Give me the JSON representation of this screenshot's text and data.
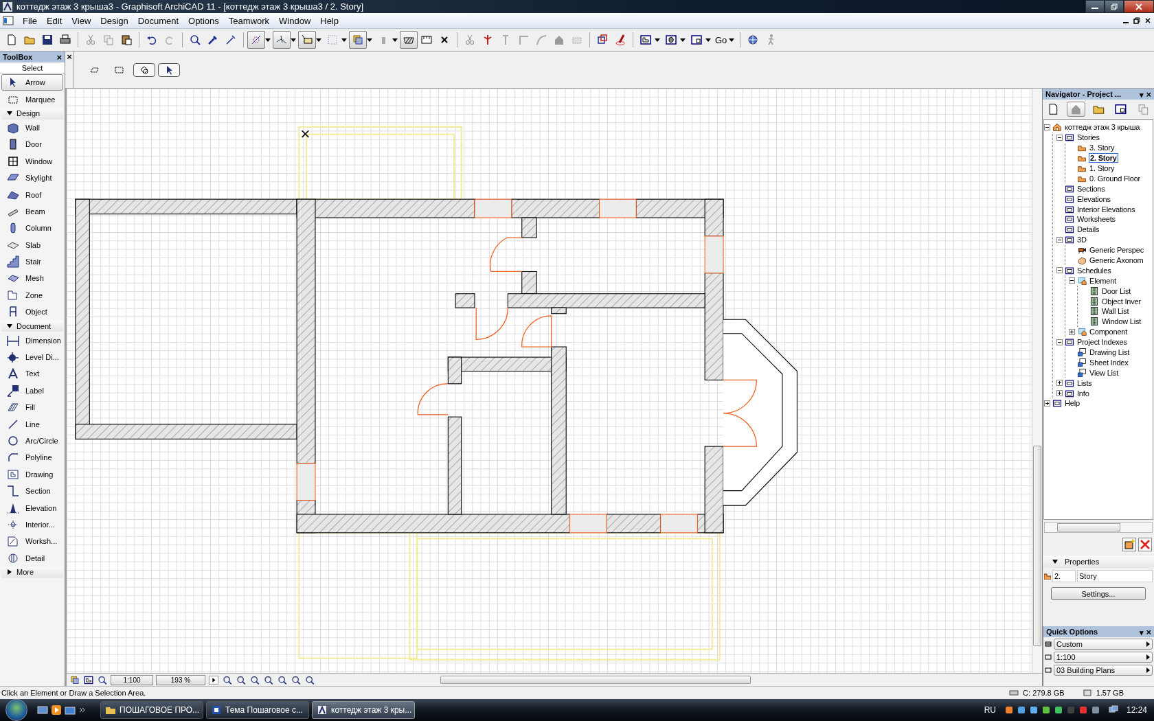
{
  "window": {
    "title": "коттедж этаж 3 крыша3 - Graphisoft ArchiCAD 11 - [коттедж этаж 3 крыша3 / 2. Story]"
  },
  "menu": [
    "File",
    "Edit",
    "View",
    "Design",
    "Document",
    "Options",
    "Teamwork",
    "Window",
    "Help"
  ],
  "toolbar": {
    "buttons": [
      {
        "pressed": false
      },
      {
        "pressed": false
      },
      {
        "pressed": false
      },
      {
        "pressed": false
      },
      {
        "pressed": false
      },
      {
        "pressed": false
      },
      {
        "pressed": false
      },
      {
        "pressed": false
      },
      {
        "pressed": false
      },
      {
        "pressed": false
      },
      {
        "pressed": false
      },
      {
        "pressed": false
      },
      {
        "pressed": true
      },
      {
        "pressed": true
      },
      {
        "pressed": true
      },
      {
        "pressed": false
      },
      {
        "pressed": true
      },
      {
        "pressed": false
      },
      {
        "pressed": true
      },
      {
        "pressed": false
      },
      {
        "pressed": false
      },
      {
        "pressed": false
      },
      {
        "pressed": false
      },
      {
        "pressed": false
      },
      {
        "pressed": false
      },
      {
        "pressed": false
      },
      {
        "pressed": false
      },
      {
        "pressed": false
      },
      {
        "pressed": false
      },
      {
        "pressed": false
      },
      {
        "pressed": false
      },
      {
        "pressed": false
      },
      {
        "pressed": false
      },
      {
        "pressed": false
      },
      {
        "pressed": false
      }
    ],
    "go_label": "Go"
  },
  "toolbox": {
    "title": "ToolBox",
    "close": "×",
    "select_label": "Select",
    "select_items": [
      {
        "label": "Arrow",
        "selected": true
      },
      {
        "label": "Marquee",
        "selected": false
      }
    ],
    "groups": [
      {
        "label": "Design",
        "expanded": true,
        "items": [
          {
            "label": "Wall",
            "selected": false
          },
          {
            "label": "Door",
            "selected": false
          },
          {
            "label": "Window",
            "selected": false
          },
          {
            "label": "Skylight",
            "selected": false
          },
          {
            "label": "Roof",
            "selected": false
          },
          {
            "label": "Beam",
            "selected": false
          },
          {
            "label": "Column",
            "selected": false
          },
          {
            "label": "Slab",
            "selected": false
          },
          {
            "label": "Stair",
            "selected": false
          },
          {
            "label": "Mesh",
            "selected": false
          },
          {
            "label": "Zone",
            "selected": false
          },
          {
            "label": "Object",
            "selected": false
          }
        ]
      },
      {
        "label": "Document",
        "expanded": true,
        "items": [
          {
            "label": "Dimension",
            "selected": false
          },
          {
            "label": "Level Di...",
            "selected": false
          },
          {
            "label": "Text",
            "selected": false
          },
          {
            "label": "Label",
            "selected": false
          },
          {
            "label": "Fill",
            "selected": false
          },
          {
            "label": "Line",
            "selected": false
          },
          {
            "label": "Arc/Circle",
            "selected": false
          },
          {
            "label": "Polyline",
            "selected": false
          },
          {
            "label": "Drawing",
            "selected": false
          },
          {
            "label": "Section",
            "selected": false
          },
          {
            "label": "Elevation",
            "selected": false
          },
          {
            "label": "Interior...",
            "selected": false
          },
          {
            "label": "Worksh...",
            "selected": false
          },
          {
            "label": "Detail",
            "selected": false
          }
        ]
      },
      {
        "label": "More",
        "expanded": false
      }
    ]
  },
  "info_box": {
    "close": "×",
    "buttons": [
      {
        "pressed": false
      },
      {
        "pressed": false
      },
      {
        "pressed": true
      },
      {
        "pressed": true
      }
    ]
  },
  "canvas_bar": {
    "scale": "1:100",
    "zoom": "193 %"
  },
  "navigator": {
    "title": "Navigator - Project ...",
    "menu_glyph": "▾",
    "close": "×",
    "view_buttons": [
      {
        "pressed": false
      },
      {
        "pressed": true
      },
      {
        "pressed": false
      },
      {
        "pressed": false
      },
      {
        "pressed": false
      }
    ],
    "tree": [
      {
        "label": "коттедж этаж 3 крыша",
        "kind": "project",
        "expanded": true,
        "selected": false,
        "children": [
          {
            "label": "Stories",
            "kind": "folder",
            "expanded": true,
            "selected": false,
            "children": [
              {
                "label": "3. Story",
                "kind": "story",
                "selected": false
              },
              {
                "label": "2. Story",
                "kind": "story",
                "selected": true
              },
              {
                "label": "1. Story",
                "kind": "story",
                "selected": false
              },
              {
                "label": "0. Ground Floor",
                "kind": "story",
                "selected": false
              }
            ]
          },
          {
            "label": "Sections",
            "kind": "folder",
            "selected": false
          },
          {
            "label": "Elevations",
            "kind": "folder",
            "selected": false
          },
          {
            "label": "Interior Elevations",
            "kind": "folder",
            "selected": false
          },
          {
            "label": "Worksheets",
            "kind": "folder",
            "selected": false
          },
          {
            "label": "Details",
            "kind": "folder",
            "selected": false
          },
          {
            "label": "3D",
            "kind": "folder",
            "expanded": true,
            "selected": false,
            "children": [
              {
                "label": "Generic Perspec",
                "kind": "camera",
                "selected": false
              },
              {
                "label": "Generic Axonom",
                "kind": "box",
                "selected": false
              }
            ]
          },
          {
            "label": "Schedules",
            "kind": "folder",
            "expanded": true,
            "selected": false,
            "children": [
              {
                "label": "Element",
                "kind": "schedule",
                "expanded": true,
                "selected": false,
                "children": [
                  {
                    "label": "Door List",
                    "kind": "table",
                    "selected": false
                  },
                  {
                    "label": "Object Inver",
                    "kind": "table",
                    "selected": false
                  },
                  {
                    "label": "Wall List",
                    "kind": "table",
                    "selected": false
                  },
                  {
                    "label": "Window List",
                    "kind": "table",
                    "selected": false
                  }
                ]
              },
              {
                "label": "Component",
                "kind": "schedule",
                "expanded": false,
                "selected": false
              }
            ]
          },
          {
            "label": "Project Indexes",
            "kind": "folder",
            "expanded": true,
            "selected": false,
            "children": [
              {
                "label": "Drawing List",
                "kind": "index",
                "selected": false
              },
              {
                "label": "Sheet Index",
                "kind": "index",
                "selected": false
              },
              {
                "label": "View List",
                "kind": "index",
                "selected": false
              }
            ]
          },
          {
            "label": "Lists",
            "kind": "folder",
            "expanded": false,
            "selected": false
          },
          {
            "label": "Info",
            "kind": "folder",
            "expanded": false,
            "selected": false
          }
        ]
      },
      {
        "label": "Help",
        "kind": "folder",
        "expanded": false,
        "selected": false
      }
    ],
    "properties": {
      "label": "Properties",
      "number": "2.",
      "name": "Story",
      "button": "Settings..."
    }
  },
  "quick_options": {
    "title": "Quick Options",
    "menu_glyph": "▾",
    "close": "×",
    "options": [
      "Custom",
      "1:100",
      "03 Building Plans"
    ]
  },
  "status_bar": {
    "message": "Click an Element or Draw a Selection Area.",
    "disk": "C: 279.8 GB",
    "memory": "1.57 GB"
  },
  "taskbar": {
    "tasks": [
      {
        "label": "ПОШАГОВОЕ ПРО...",
        "selected": false
      },
      {
        "label": "Тема Пошаговое с...",
        "selected": false
      },
      {
        "label": "коттедж этаж 3 кры...",
        "selected": true
      }
    ],
    "language": "RU",
    "clock": "12:24"
  }
}
